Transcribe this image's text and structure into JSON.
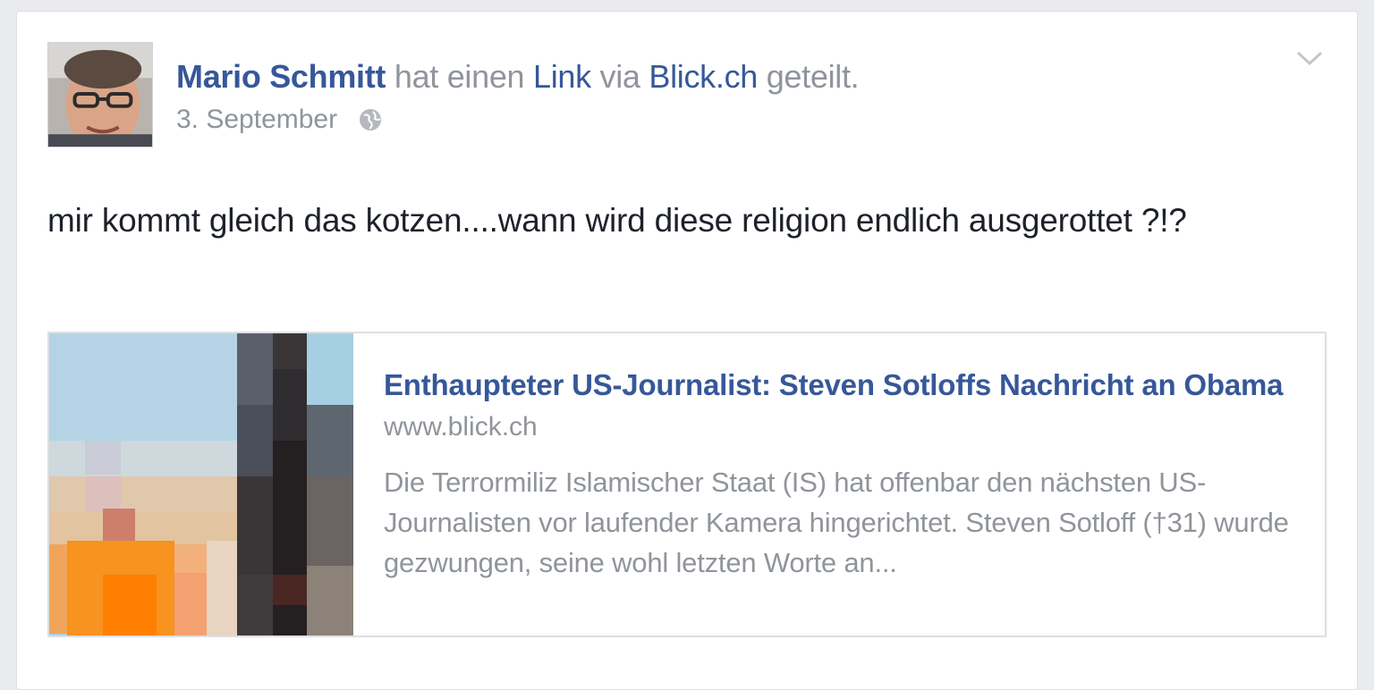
{
  "post": {
    "author": "Mario Schmitt",
    "action_text_1": " hat einen ",
    "link_word": "Link",
    "action_text_2": " via ",
    "source": "Blick.ch",
    "action_text_3": " geteilt.",
    "date": "3. September",
    "privacy_icon": "globe-icon",
    "menu_icon": "chevron-down-icon",
    "message": "mir kommt gleich das kotzen....wann wird diese religion endlich ausgerottet ?!?"
  },
  "link_preview": {
    "title": "Enthaupteter US-Journalist: Steven Sotloffs Nachricht an Obama",
    "domain": "www.blick.ch",
    "description": "Die Terrormiliz Islamischer Staat (IS) hat offenbar den nächsten US-Journalisten vor laufender Kamera hingerichtet. Steven Sotloff (†31) wurde gezwungen, seine wohl letzten Worte an..."
  },
  "colors": {
    "link_blue": "#365899",
    "meta_gray": "#90949c",
    "text_dark": "#1d2129"
  }
}
